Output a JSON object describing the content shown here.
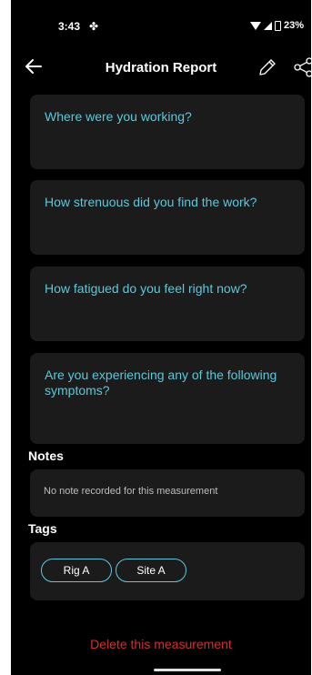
{
  "status_bar": {
    "time": "3:43",
    "battery": "23%"
  },
  "app_bar": {
    "title": "Hydration Report"
  },
  "questions": [
    "Where were you working?",
    "How strenuous did you find the work?",
    "How fatigued do you feel right now?",
    "Are you experiencing any of the following symptoms?"
  ],
  "notes": {
    "label": "Notes",
    "text": "No note recorded for this measurement"
  },
  "tags": {
    "label": "Tags",
    "items": [
      "Rig A",
      "Site A"
    ]
  },
  "actions": {
    "delete_label": "Delete this measurement"
  },
  "colors": {
    "accent": "#5bc8da",
    "danger": "#d32f2f",
    "card_background": "#1b1b1b",
    "background": "#000000"
  }
}
